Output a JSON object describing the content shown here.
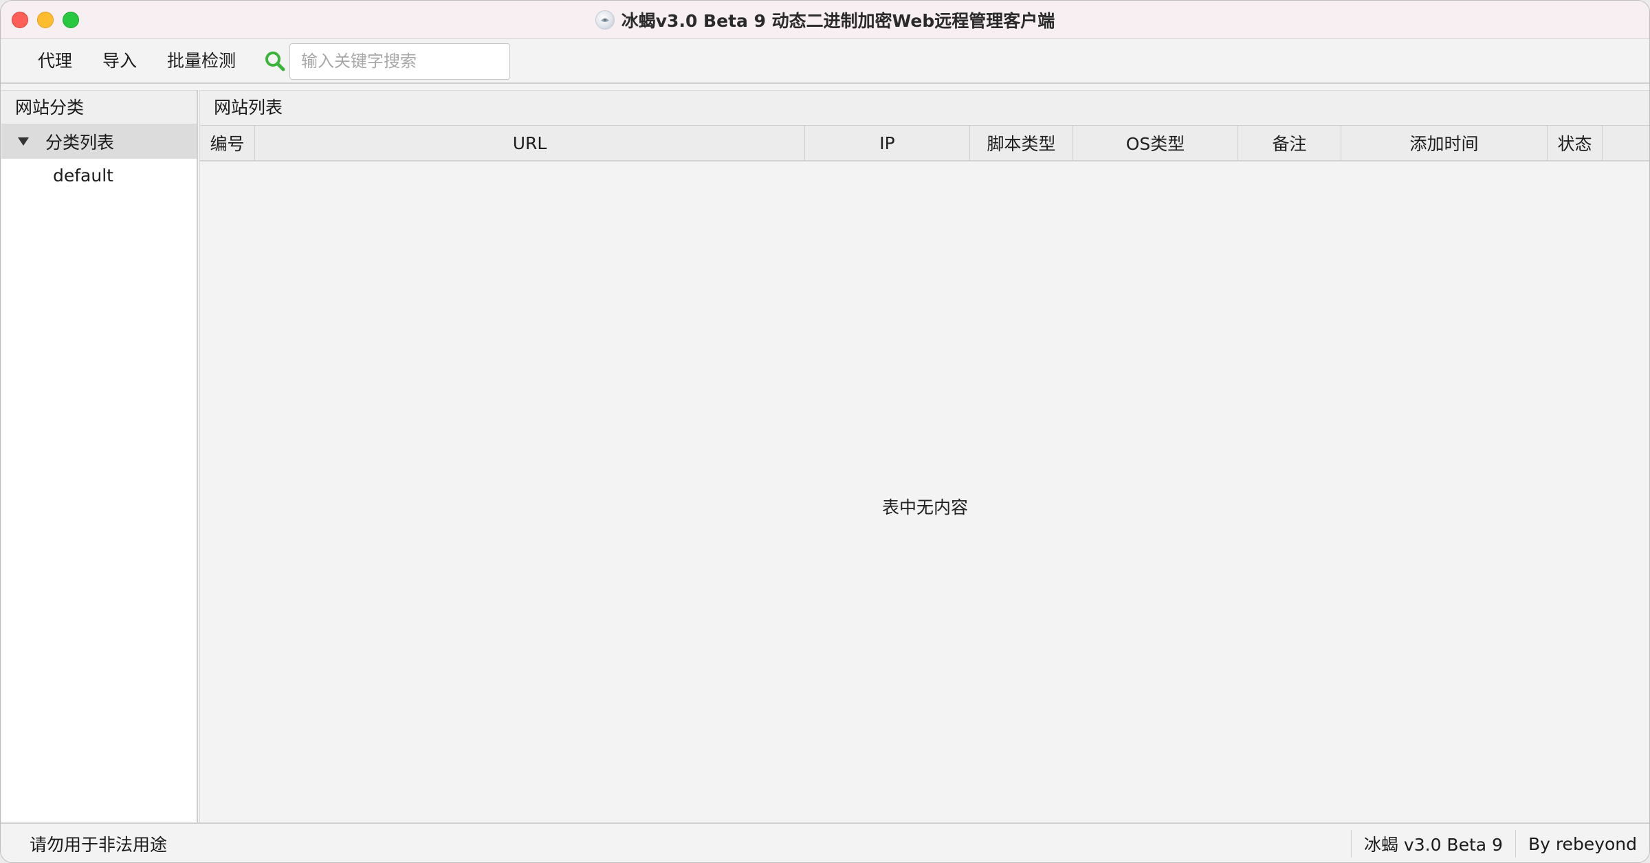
{
  "window": {
    "title": "冰蝎v3.0 Beta 9 动态二进制加密Web远程管理客户端"
  },
  "toolbar": {
    "menu": [
      "代理",
      "导入",
      "批量检测"
    ],
    "search_placeholder": "输入关键字搜索",
    "search_value": ""
  },
  "left_panel": {
    "header": "网站分类",
    "tree": {
      "root_label": "分类列表",
      "children": [
        "default"
      ]
    }
  },
  "right_panel": {
    "header": "网站列表",
    "columns": [
      "编号",
      "URL",
      "IP",
      "脚本类型",
      "OS类型",
      "备注",
      "添加时间",
      "状态"
    ],
    "empty_message": "表中无内容"
  },
  "status_bar": {
    "left": "请勿用于非法用途",
    "version": "冰蝎 v3.0 Beta 9",
    "author": "By rebeyond"
  },
  "colors": {
    "search_icon": "#3cb43c",
    "titlebar_bg": "#f7eff2",
    "tree_selected_bg": "#dcdcdc"
  },
  "icons": {
    "search": "search-icon",
    "app": "app-icon",
    "tree_expand": "triangle-down-icon"
  }
}
